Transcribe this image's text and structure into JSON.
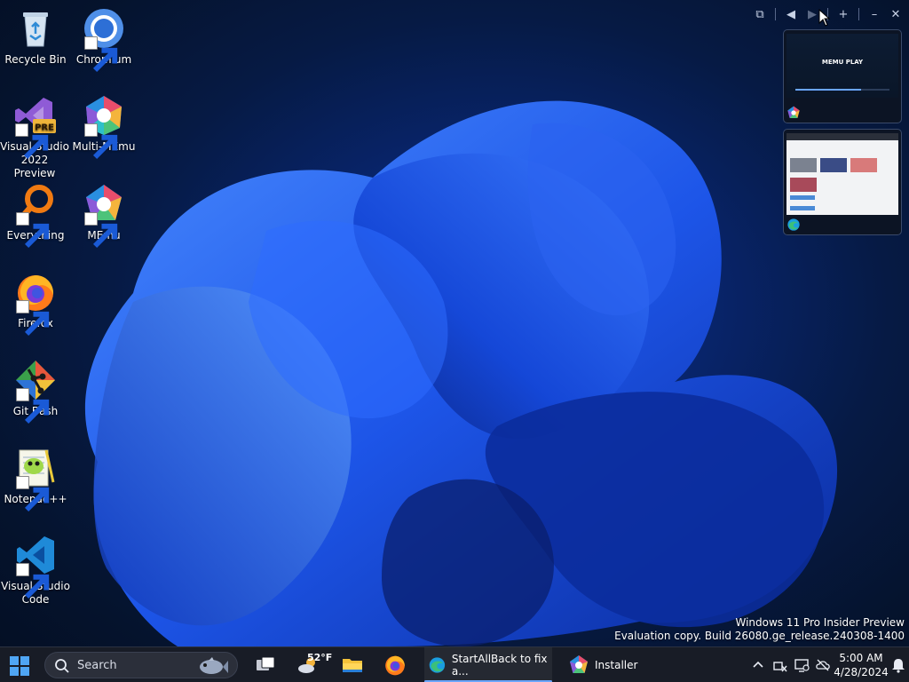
{
  "desktop": {
    "icons": [
      {
        "label": "Recycle Bin",
        "icon": "recycle-bin-icon"
      },
      {
        "label": "Chromium",
        "icon": "chromium-icon"
      },
      {
        "label": "Visual Studio 2022 Preview",
        "icon": "visual-studio-preview-icon",
        "badge": "PRE"
      },
      {
        "label": "Multi-MEmu",
        "icon": "multi-memu-icon"
      },
      {
        "label": "Everything",
        "icon": "everything-search-icon"
      },
      {
        "label": "MEmu",
        "icon": "memu-icon"
      },
      {
        "label": "Firefox",
        "icon": "firefox-icon"
      },
      {
        "label": "Git Bash",
        "icon": "git-bash-icon"
      },
      {
        "label": "Notepad++",
        "icon": "notepadpp-icon"
      },
      {
        "label": "Visual Studio Code",
        "icon": "vscode-icon"
      }
    ]
  },
  "watermark": {
    "line1": "Windows 11 Pro Insider Preview",
    "line2": "Evaluation copy. Build 26080.ge_release.240308-1400"
  },
  "taskbar": {
    "search_placeholder": "Search",
    "weather_temp": "52°F",
    "tasks": [
      {
        "label": "StartAllBack to fix a...",
        "icon": "edge-icon",
        "active": true
      },
      {
        "label": "Installer",
        "icon": "memu-icon",
        "active": false
      }
    ],
    "clock": {
      "time": "5:00 AM",
      "date": "4/28/2024"
    }
  },
  "thumbnails": {
    "memu_brand": "MEMU PLAY"
  },
  "colors": {
    "accent": "#6aa6ff",
    "taskbar_bg": "#181c26"
  }
}
